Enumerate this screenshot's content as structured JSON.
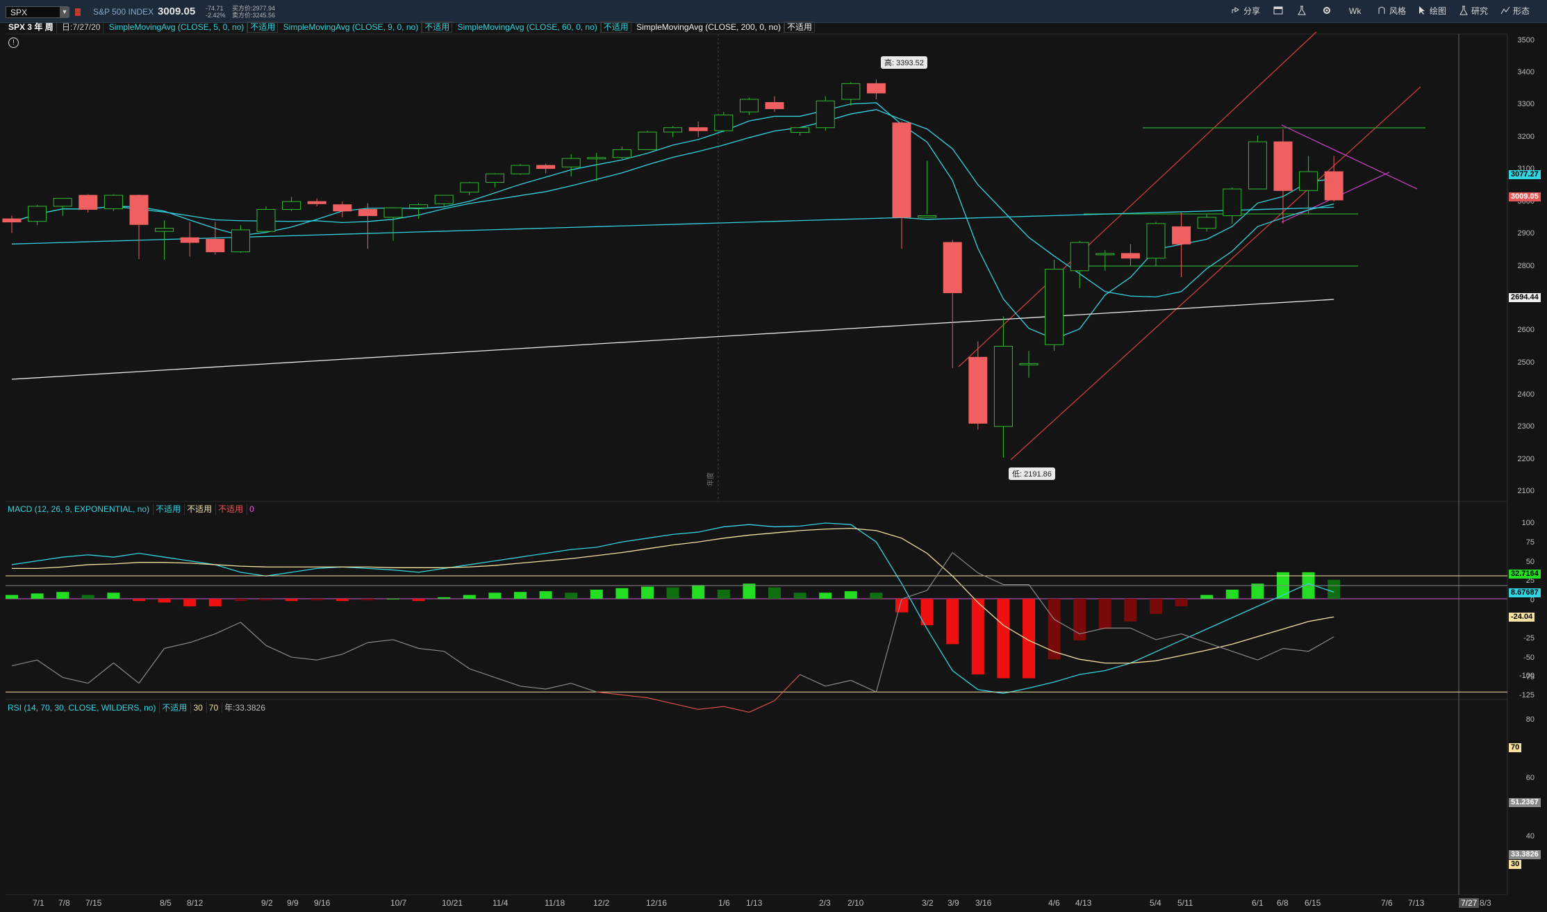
{
  "toolbar": {
    "symbol": "SPX",
    "index_name": "S&P 500 INDEX",
    "last_price": "3009.05",
    "net_change": "-74.71",
    "percent_change": "-2.42%",
    "bid": "买方价:2977.94",
    "ask": "卖方价:3245.56",
    "buttons": [
      {
        "label": "分享",
        "icon": "share-icon"
      },
      {
        "label": "",
        "icon": "window-icon"
      },
      {
        "label": "",
        "icon": "flask-icon"
      },
      {
        "label": "",
        "icon": "gear-icon"
      },
      {
        "label": "Wk",
        "icon": ""
      },
      {
        "label": "风格",
        "icon": "style-icon"
      },
      {
        "label": "绘图",
        "icon": "cursor-icon"
      },
      {
        "label": "研究",
        "icon": "flask-icon"
      },
      {
        "label": "形态",
        "icon": "pattern-icon"
      }
    ]
  },
  "study_bar": {
    "period": "SPX 3 年 周",
    "date": "日:7/27/20",
    "studies": [
      {
        "name": "SimpleMovingAvg (CLOSE, 5, 0, no)",
        "status": "不适用"
      },
      {
        "name": "SimpleMovingAvg (CLOSE, 9, 0, no)",
        "status": "不适用"
      },
      {
        "name": "SimpleMovingAvg (CLOSE, 60, 0, no)",
        "status": "不适用"
      },
      {
        "name": "SimpleMovingAvg (CLOSE, 200, 0, no)",
        "status": "不适用"
      }
    ]
  },
  "price_panel": {
    "y_ticks": [
      "3500",
      "3400",
      "3300",
      "3200",
      "3100",
      "3000",
      "2900",
      "2800",
      "2700",
      "2600",
      "2500",
      "2400",
      "2300",
      "2200",
      "2100"
    ],
    "tags": {
      "sma5": "3077.27",
      "last": "3009.05",
      "sma200": "2694.44"
    },
    "high_callout": "高: 3393.52",
    "low_callout": "低: 2191.86",
    "vertical_marker": "年度"
  },
  "macd_panel": {
    "header": "MACD (12, 26, 9, EXPONENTIAL, no)",
    "status1": "不适用",
    "status2": "不适用",
    "status3": "不适用",
    "zero": "0",
    "y_ticks": [
      "100",
      "75",
      "50",
      "25",
      "0",
      "-25",
      "-50",
      "-75",
      "-100",
      "-125"
    ],
    "tags": {
      "diff": "32.7164",
      "value": "8.67687",
      "avg": "-24.04"
    }
  },
  "rsi_panel": {
    "header": "RSI (14, 70, 30, CLOSE, WILDERS, no)",
    "status": "不适用",
    "ob": "30",
    "os": "70",
    "value_text": "年:33.3826",
    "y_ticks": [
      "80",
      "70",
      "60",
      "50",
      "40",
      "30",
      "20"
    ],
    "tags": {
      "rsi": "51.2367",
      "hl": "33.3826",
      "ob": "70",
      "os": "30"
    }
  },
  "x_axis": {
    "labels": [
      "7/1",
      "7/8",
      "7/15",
      "8/5",
      "8/12",
      "9/2",
      "9/9",
      "9/16",
      "10/7",
      "10/21",
      "11/4",
      "11/18",
      "12/2",
      "12/16",
      "1/6",
      "1/13",
      "2/3",
      "2/10",
      "3/2",
      "3/9",
      "3/16",
      "4/6",
      "4/13",
      "5/4",
      "5/11",
      "6/1",
      "6/8",
      "6/15",
      "7/6",
      "7/13",
      "8/3"
    ],
    "current": "7/27"
  },
  "chart_data": {
    "type": "candlestick",
    "price_range": [
      2080,
      3530
    ],
    "weeks": [
      "2019-06-24",
      "2019-07-01",
      "2019-07-08",
      "2019-07-15",
      "2019-07-22",
      "2019-07-29",
      "2019-08-05",
      "2019-08-12",
      "2019-08-19",
      "2019-08-26",
      "2019-09-02",
      "2019-09-09",
      "2019-09-16",
      "2019-09-23",
      "2019-09-30",
      "2019-10-07",
      "2019-10-14",
      "2019-10-21",
      "2019-10-28",
      "2019-11-04",
      "2019-11-11",
      "2019-11-18",
      "2019-11-25",
      "2019-12-02",
      "2019-12-09",
      "2019-12-16",
      "2019-12-23",
      "2019-12-30",
      "2020-01-06",
      "2020-01-13",
      "2020-01-20",
      "2020-01-27",
      "2020-02-03",
      "2020-02-10",
      "2020-02-17",
      "2020-02-24",
      "2020-03-02",
      "2020-03-09",
      "2020-03-16",
      "2020-03-23",
      "2020-03-30",
      "2020-04-06",
      "2020-04-13",
      "2020-04-20",
      "2020-04-27",
      "2020-05-04",
      "2020-05-11",
      "2020-05-18",
      "2020-05-25",
      "2020-06-01",
      "2020-06-08",
      "2020-06-15",
      "2020-06-22"
    ],
    "ohlc": [
      [
        2950,
        2960,
        2905,
        2940
      ],
      [
        2942,
        2995,
        2930,
        2990
      ],
      [
        2990,
        3015,
        2960,
        3015
      ],
      [
        3025,
        3028,
        2970,
        2980
      ],
      [
        2982,
        3028,
        2975,
        3025
      ],
      [
        3025,
        3027,
        2822,
        2932
      ],
      [
        2910,
        2945,
        2820,
        2920
      ],
      [
        2890,
        2940,
        2830,
        2875
      ],
      [
        2885,
        2940,
        2836,
        2845
      ],
      [
        2845,
        2930,
        2842,
        2915
      ],
      [
        2910,
        2990,
        2905,
        2980
      ],
      [
        2980,
        3020,
        2975,
        3005
      ],
      [
        3005,
        3015,
        2990,
        2998
      ],
      [
        2995,
        3005,
        2955,
        2975
      ],
      [
        2980,
        3000,
        2855,
        2960
      ],
      [
        2955,
        2980,
        2880,
        2985
      ],
      [
        2985,
        3000,
        2950,
        2995
      ],
      [
        2998,
        3025,
        2990,
        3025
      ],
      [
        3035,
        3068,
        3025,
        3065
      ],
      [
        3066,
        3095,
        3050,
        3093
      ],
      [
        3093,
        3125,
        3090,
        3120
      ],
      [
        3120,
        3125,
        3095,
        3110
      ],
      [
        3115,
        3155,
        3085,
        3142
      ],
      [
        3142,
        3160,
        3070,
        3145
      ],
      [
        3145,
        3180,
        3140,
        3170
      ],
      [
        3170,
        3230,
        3170,
        3226
      ],
      [
        3226,
        3245,
        3210,
        3240
      ],
      [
        3240,
        3260,
        3210,
        3230
      ],
      [
        3230,
        3290,
        3225,
        3280
      ],
      [
        3290,
        3335,
        3280,
        3330
      ],
      [
        3320,
        3340,
        3290,
        3300
      ],
      [
        3225,
        3240,
        3215,
        3240
      ],
      [
        3240,
        3340,
        3230,
        3325
      ],
      [
        3330,
        3385,
        3310,
        3380
      ],
      [
        3380,
        3393,
        3330,
        3350
      ],
      [
        3255,
        3260,
        2855,
        2955
      ],
      [
        2955,
        3135,
        2965,
        2960
      ],
      [
        2875,
        2883,
        2475,
        2715
      ],
      [
        2510,
        2560,
        2280,
        2300
      ],
      [
        2290,
        2640,
        2191,
        2545
      ],
      [
        2490,
        2530,
        2445,
        2490
      ],
      [
        2550,
        2820,
        2530,
        2790
      ],
      [
        2785,
        2880,
        2730,
        2875
      ],
      [
        2838,
        2850,
        2785,
        2840
      ],
      [
        2840,
        2870,
        2800,
        2825
      ],
      [
        2825,
        2940,
        2800,
        2935
      ],
      [
        2925,
        2970,
        2765,
        2870
      ],
      [
        2920,
        2965,
        2910,
        2955
      ],
      [
        2960,
        3050,
        2935,
        3045
      ],
      [
        3045,
        3215,
        3045,
        3195
      ],
      [
        3195,
        3235,
        2935,
        3040
      ],
      [
        3040,
        3150,
        2965,
        3100
      ],
      [
        3100,
        3150,
        3005,
        3010
      ]
    ],
    "sma200": {
      "start": 2440,
      "end": 2694
    },
    "macd": {
      "histogram": [
        5,
        7,
        9,
        5,
        8,
        -3,
        -5,
        -10,
        -10,
        -3,
        -2,
        -3,
        -2,
        -3,
        -2,
        0,
        -3,
        2,
        5,
        8,
        9,
        10,
        8,
        12,
        14,
        16,
        15,
        18,
        12,
        20,
        15,
        8,
        8,
        10,
        8,
        -18,
        -35,
        -60,
        -100,
        -105,
        -105,
        -80,
        -55,
        -40,
        -30,
        -20,
        -10,
        5,
        12,
        20,
        35,
        35,
        25
      ],
      "macd": [
        45,
        50,
        55,
        58,
        55,
        60,
        55,
        50,
        45,
        35,
        30,
        35,
        40,
        42,
        40,
        38,
        35,
        40,
        45,
        50,
        55,
        60,
        65,
        68,
        75,
        80,
        85,
        88,
        95,
        98,
        95,
        96,
        100,
        98,
        75,
        20,
        -40,
        -95,
        -120,
        -125,
        -118,
        -110,
        -100,
        -95,
        -85,
        -70,
        -55,
        -40,
        -25,
        -10,
        5,
        20,
        8.7
      ],
      "signal": [
        40,
        40,
        42,
        45,
        46,
        48,
        48,
        47,
        45,
        43,
        42,
        42,
        42,
        42,
        42,
        41,
        41,
        41,
        42,
        44,
        47,
        50,
        53,
        57,
        61,
        66,
        71,
        75,
        80,
        84,
        87,
        90,
        92,
        93,
        90,
        80,
        60,
        30,
        -5,
        -35,
        -55,
        -70,
        -80,
        -85,
        -85,
        -82,
        -75,
        -68,
        -60,
        -50,
        -40,
        -30,
        -24
      ]
    },
    "rsi": [
      61,
      59,
      65,
      67,
      60,
      67,
      55,
      53,
      50,
      46,
      54,
      58,
      59,
      57,
      53,
      52,
      55,
      56,
      62,
      65,
      68,
      69,
      67,
      70,
      71,
      72,
      74,
      76,
      75,
      77,
      73,
      64,
      68,
      66,
      70,
      38,
      35,
      22,
      29,
      33,
      33,
      45,
      50,
      48,
      48,
      52,
      50,
      53,
      56,
      59,
      55,
      56,
      51
    ]
  }
}
